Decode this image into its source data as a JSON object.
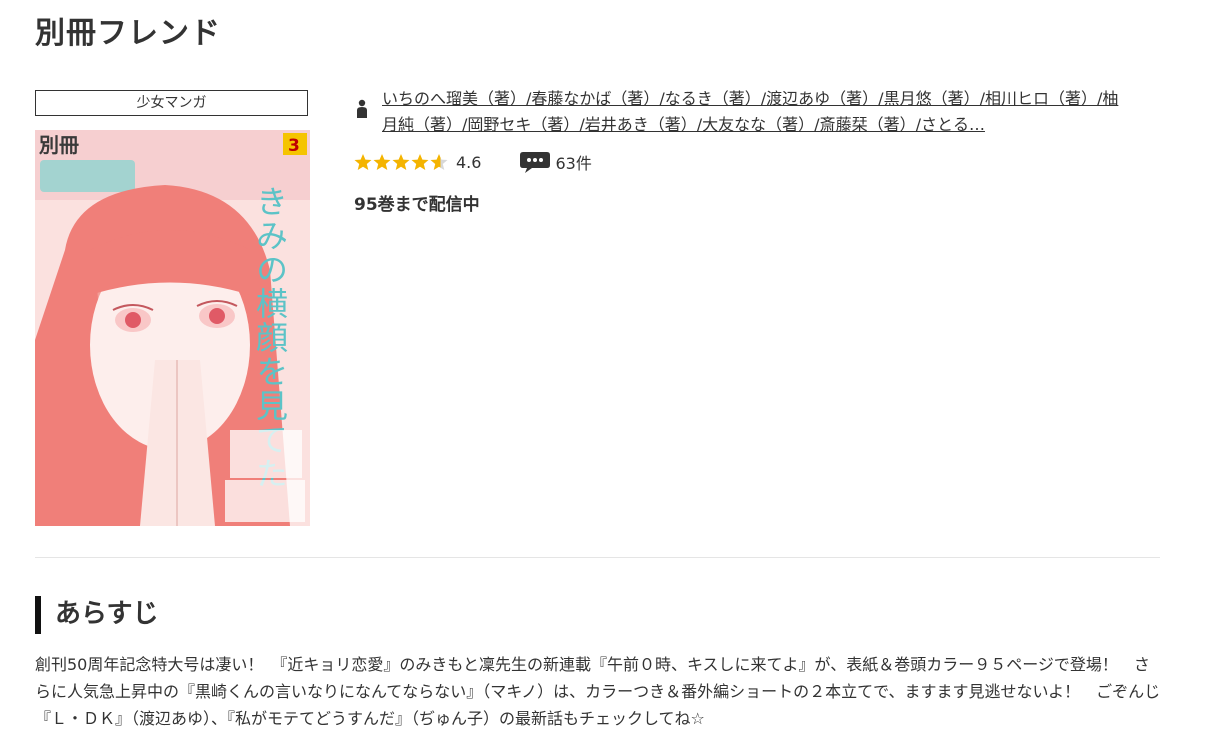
{
  "page": {
    "title": "別冊フレンド"
  },
  "category": {
    "label": "少女マンガ"
  },
  "cover": {
    "badge": "3",
    "vertical_title": "きみの横顔を見てた",
    "masthead": "別冊",
    "colors": {
      "background": "#fbe1df",
      "hair": "#f07f79",
      "skin": "#fdeeec",
      "title_color": "#5cc3c7"
    }
  },
  "book": {
    "authors": "いちのへ瑠美（著）/春藤なかば（著）/なるき（著）/渡辺あゆ（著）/黒月悠（著）/相川ヒロ（著）/柚月純（著）/岡野セキ（著）/岩井あき（著）/大友なな（著）/斎藤栞（著）/さとる…",
    "rating": {
      "value": 4.6,
      "display": "4.6",
      "max": 5
    },
    "reviews": {
      "count_label": "63件"
    },
    "volumes_label": "95巻まで配信中",
    "icons": {
      "author": "person-icon",
      "reviews": "speech-bubble-icon"
    },
    "colors": {
      "star": "#f4b400",
      "star_empty": "#d8d8d8"
    }
  },
  "synopsis": {
    "heading": "あらすじ",
    "text": "創刊50周年記念特大号は凄い！　『近キョリ恋愛』のみきもと凜先生の新連載『午前０時、キスしに来てよ』が、表紙＆巻頭カラー９５ページで登場！　さらに人気急上昇中の『黒崎くんの言いなりになんてならない』（マキノ）は、カラーつき＆番外編ショートの２本立てで、ますます見逃せないよ！　ごぞんじ『Ｌ・ＤＫ』（渡辺あゆ）、『私がモテてどうすんだ』（ぢゅん子）の最新話もチェックしてね☆"
  }
}
